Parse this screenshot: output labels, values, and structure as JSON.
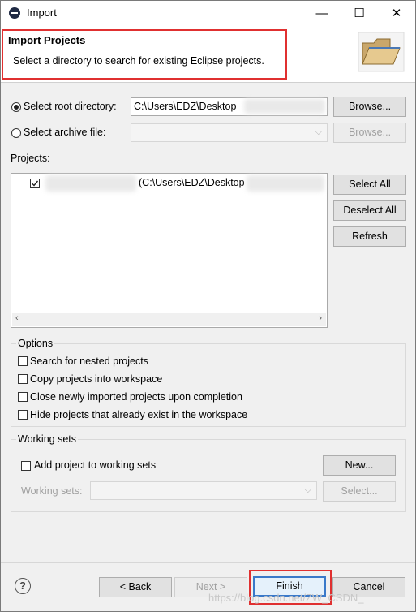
{
  "window": {
    "title": "Import",
    "icon": "eclipse-icon"
  },
  "titlebar_buttons": {
    "minimize": "—",
    "maximize": "☐",
    "close": "✕"
  },
  "header": {
    "title": "Import Projects",
    "description": "Select a directory to search for existing Eclipse projects.",
    "icon": "folder-icon",
    "highlight_color": "#e03030"
  },
  "root_directory": {
    "label": "Select root directory:",
    "value": "C:\\Users\\EDZ\\Desktop",
    "selected": true,
    "browse": "Browse..."
  },
  "archive_file": {
    "label": "Select archive file:",
    "value": "",
    "selected": false,
    "browse": "Browse..."
  },
  "projects": {
    "label": "Projects:",
    "items": [
      {
        "checked": true,
        "text": "(C:\\Users\\EDZ\\Desktop"
      }
    ],
    "buttons": {
      "select_all": "Select All",
      "deselect_all": "Deselect All",
      "refresh": "Refresh"
    }
  },
  "options": {
    "legend": "Options",
    "items": [
      {
        "label": "Search for nested projects",
        "checked": false
      },
      {
        "label": "Copy projects into workspace",
        "checked": false
      },
      {
        "label": "Close newly imported projects upon completion",
        "checked": false
      },
      {
        "label": "Hide projects that already exist in the workspace",
        "checked": false
      }
    ]
  },
  "working_sets": {
    "legend": "Working sets",
    "add_label": "Add project to working sets",
    "add_checked": false,
    "new_button": "New...",
    "sets_label": "Working sets:",
    "select_button": "Select..."
  },
  "footer": {
    "help": "?",
    "back": "< Back",
    "next": "Next >",
    "finish": "Finish",
    "cancel": "Cancel"
  },
  "watermark": "https://blog.csdn.net/ZW_CSDN_"
}
